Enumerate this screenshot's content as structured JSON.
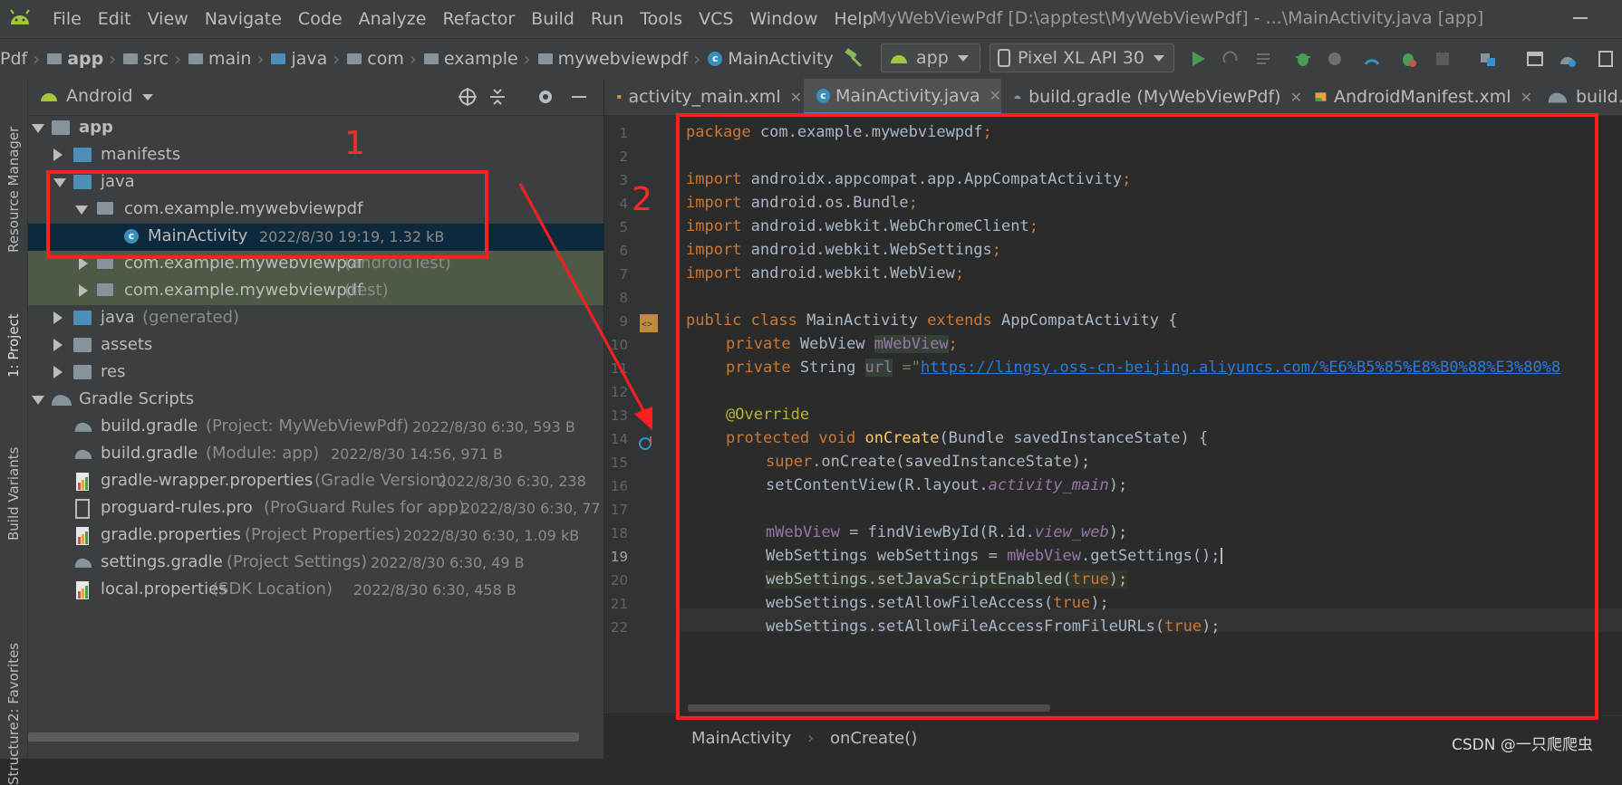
{
  "menubar": {
    "items": [
      "File",
      "Edit",
      "View",
      "Navigate",
      "Code",
      "Analyze",
      "Refactor",
      "Build",
      "Run",
      "Tools",
      "VCS",
      "Window",
      "Help"
    ],
    "window_title": "MyWebViewPdf [D:\\apptest\\MyWebViewPdf] - ...\\MainActivity.java [app]"
  },
  "navbar": {
    "crumbs": [
      "Pdf",
      "app",
      "src",
      "main",
      "java",
      "com",
      "example",
      "mywebviewpdf",
      "MainActivity"
    ],
    "run_config": "app",
    "device": "Pixel XL API 30"
  },
  "left_strip": {
    "tabs": [
      "Resource Manager",
      "1: Project",
      "Build Variants",
      "2: Favorites",
      "Structure"
    ]
  },
  "project": {
    "view_mode": "Android",
    "tree": [
      {
        "name": "app",
        "detail": ""
      },
      {
        "name": "manifests",
        "detail": ""
      },
      {
        "name": "java",
        "detail": ""
      },
      {
        "name": "com.example.mywebviewpdf",
        "detail": ""
      },
      {
        "name": "MainActivity",
        "detail": "2022/8/30 19:19, 1.32 kB"
      },
      {
        "name": "com.example.mywebviewpdf",
        "detail": "(androidTest)"
      },
      {
        "name": "com.example.mywebviewpdf",
        "detail": "(test)"
      },
      {
        "name": "java",
        "detail": "(generated)"
      },
      {
        "name": "assets",
        "detail": ""
      },
      {
        "name": "res",
        "detail": ""
      },
      {
        "name": "Gradle Scripts",
        "detail": ""
      },
      {
        "name": "build.gradle",
        "detail": "(Project: MyWebViewPdf)",
        "meta": "2022/8/30 6:30, 593 B"
      },
      {
        "name": "build.gradle",
        "detail": "(Module: app)",
        "meta": "2022/8/30 14:56, 971 B"
      },
      {
        "name": "gradle-wrapper.properties",
        "detail": "(Gradle Version)",
        "meta": "2022/8/30 6:30, 238"
      },
      {
        "name": "proguard-rules.pro",
        "detail": "(ProGuard Rules for app)",
        "meta": "2022/8/30 6:30, 77"
      },
      {
        "name": "gradle.properties",
        "detail": "(Project Properties)",
        "meta": "2022/8/30 6:30, 1.09 kB"
      },
      {
        "name": "settings.gradle",
        "detail": "(Project Settings)",
        "meta": "2022/8/30 6:30, 49 B"
      },
      {
        "name": "local.properties",
        "detail": "(SDK Location)",
        "meta": "2022/8/30 6:30, 458 B"
      }
    ]
  },
  "editor": {
    "tabs": [
      "activity_main.xml",
      "MainActivity.java",
      "build.gradle (MyWebViewPdf)",
      "AndroidManifest.xml",
      "build."
    ],
    "line_numbers": [
      "1",
      "2",
      "3",
      "4",
      "5",
      "6",
      "7",
      "8",
      "9",
      "10",
      "11",
      "12",
      "13",
      "14",
      "15",
      "16",
      "17",
      "18",
      "19",
      "20",
      "21",
      "22"
    ],
    "current_line": "19",
    "code": {
      "l1_kw": "package",
      "l1_rest": " com.example.mywebviewpdf",
      "imp_kw": "import",
      "l3": " androidx.appcompat.app.AppCompatActivity",
      "l4": " android.os.Bundle",
      "l5": " android.webkit.WebChromeClient",
      "l6": " android.webkit.WebSettings",
      "l7": " android.webkit.WebView",
      "semi": ";",
      "l9_kw1": "public class",
      "l9_name": " MainActivity ",
      "l9_kw2": "extends",
      "l9_rest": " AppCompatActivity {",
      "private_kw": "private",
      "l10_type": " WebView ",
      "l10_field": "mWebView",
      "l11_type": " String ",
      "l11_field": "url",
      "l11_eq": " =\"",
      "l11_url": "https://lingsy.oss-cn-beijing.aliyuncs.com/%E6%B5%85%E8%B0%88%E3%80%8",
      "l13": "@Override",
      "l14_kw": "protected void",
      "l14_fn": "onCreate",
      "l14_rest": "(Bundle savedInstanceState) {",
      "l15_kw": "super",
      "l15_rest": ".onCreate(savedInstanceState);",
      "l16_a": "setContentView(R.layout.",
      "l16_b": "activity_main",
      "l16_c": ");",
      "l18_field": "mWebView",
      "l18_a": " = findViewById(R.id.",
      "l18_b": "view_web",
      "l18_c": ");",
      "l19_a": "WebSettings webSettings = ",
      "l19_field": "mWebView",
      "l19_b": ".getSettings();",
      "l20_a": "webSettings.setJavaScriptEnabled(",
      "true_kw": "true",
      "close": ");",
      "l21_a": "webSettings.setAllowFileAccess(",
      "l22_a": "webSettings.setAllowFileAccessFromFileURLs("
    },
    "breadcrumb": [
      "MainActivity",
      "onCreate()"
    ]
  },
  "annotations": {
    "n1": "1",
    "n2": "2",
    "color": "#ff1f1f"
  },
  "watermark": "CSDN @一只爬爬虫"
}
